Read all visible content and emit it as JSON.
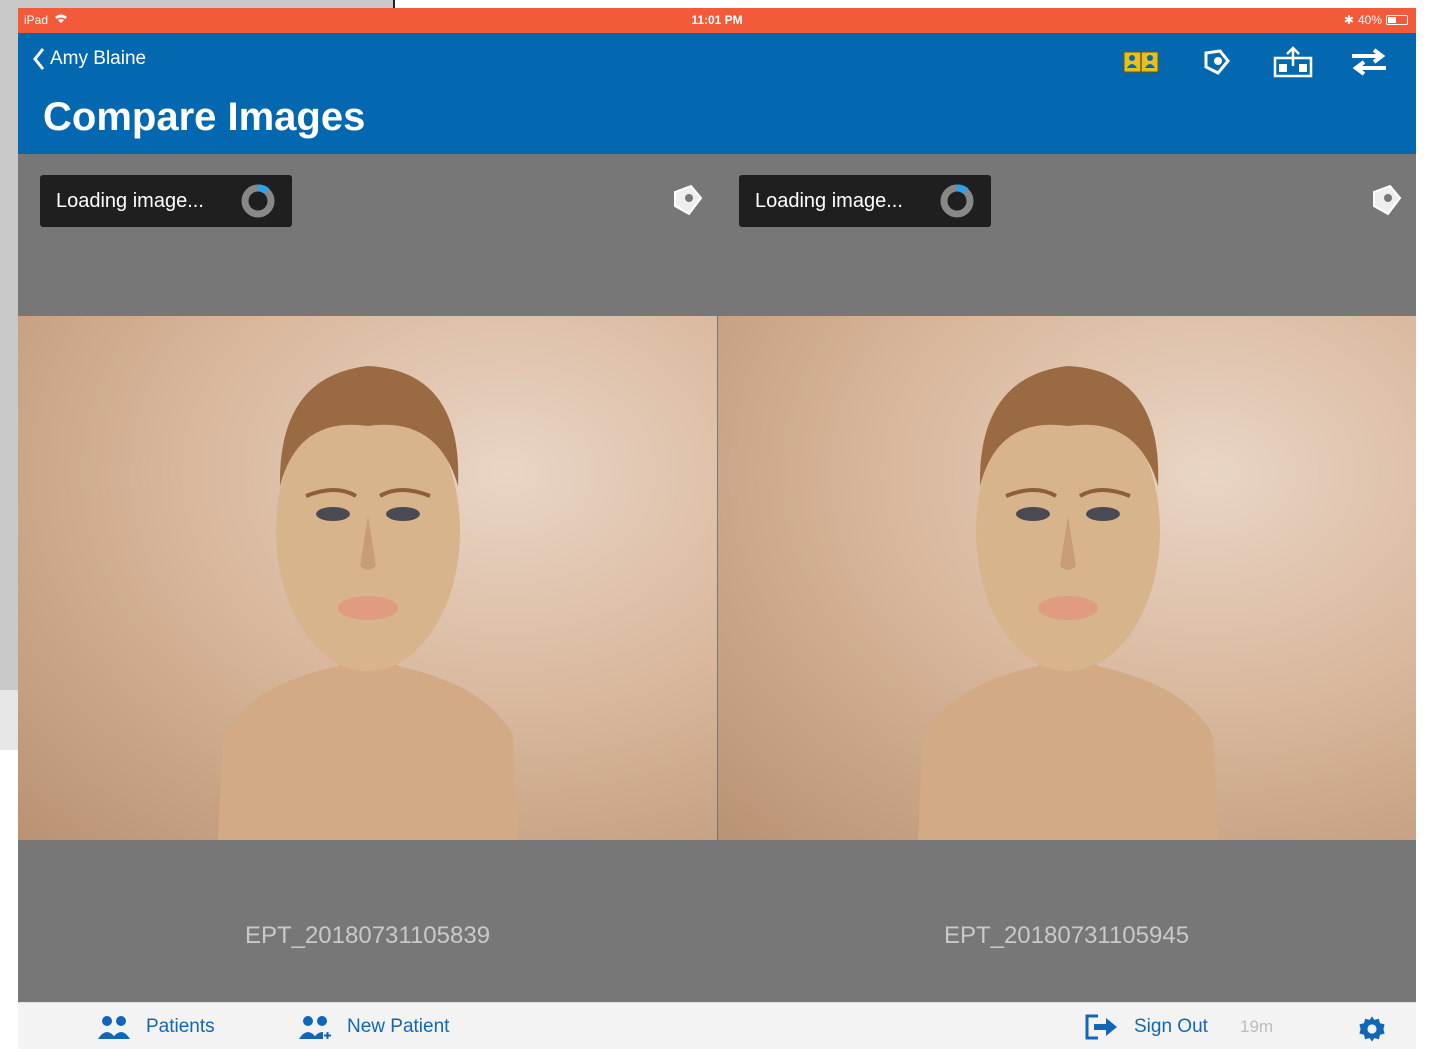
{
  "statusbar": {
    "carrier": "iPad",
    "time": "11:01 PM",
    "battery": "40%"
  },
  "navbar": {
    "back_label": "Amy Blaine",
    "title": "Compare Images",
    "icons": [
      "side-by-side-icon",
      "diagnose-icon",
      "share-upload-icon",
      "swap-icon"
    ],
    "accent": "#0468b1",
    "highlight": "#e6c021"
  },
  "panes": [
    {
      "loading_text": "Loading image...",
      "filename": "EPT_20180731105839"
    },
    {
      "loading_text": "Loading image...",
      "filename": "EPT_20180731105945"
    }
  ],
  "tabbar": {
    "patients": "Patients",
    "new_patient": "New Patient",
    "sign_out": "Sign Out",
    "timer": "19m"
  },
  "colors": {
    "statusbar": "#f25a3a",
    "panel": "#777777",
    "tab_text": "#1266b7"
  }
}
